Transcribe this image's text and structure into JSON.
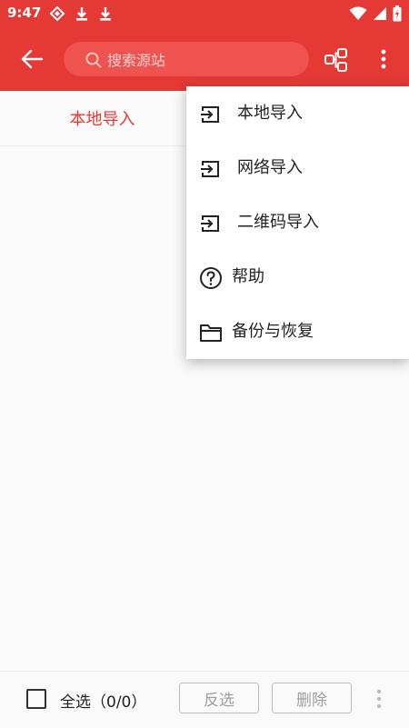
{
  "status": {
    "time": "9:47"
  },
  "appbar": {
    "search_placeholder": "搜索源站"
  },
  "tabs": [
    {
      "label": "本地导入",
      "active": true
    }
  ],
  "menu": {
    "items": [
      {
        "label": "本地导入",
        "icon": "import-icon"
      },
      {
        "label": "网络导入",
        "icon": "import-icon"
      },
      {
        "label": "二维码导入",
        "icon": "import-icon"
      },
      {
        "label": "帮助",
        "icon": "help-icon"
      },
      {
        "label": "备份与恢复",
        "icon": "folder-icon"
      }
    ]
  },
  "bottom": {
    "select_all_label": "全选（0/0）",
    "invert_label": "反选",
    "delete_label": "删除"
  },
  "colors": {
    "primary": "#e53935",
    "search_bg": "#ef5350",
    "disabled_text": "#9e9e9e"
  }
}
